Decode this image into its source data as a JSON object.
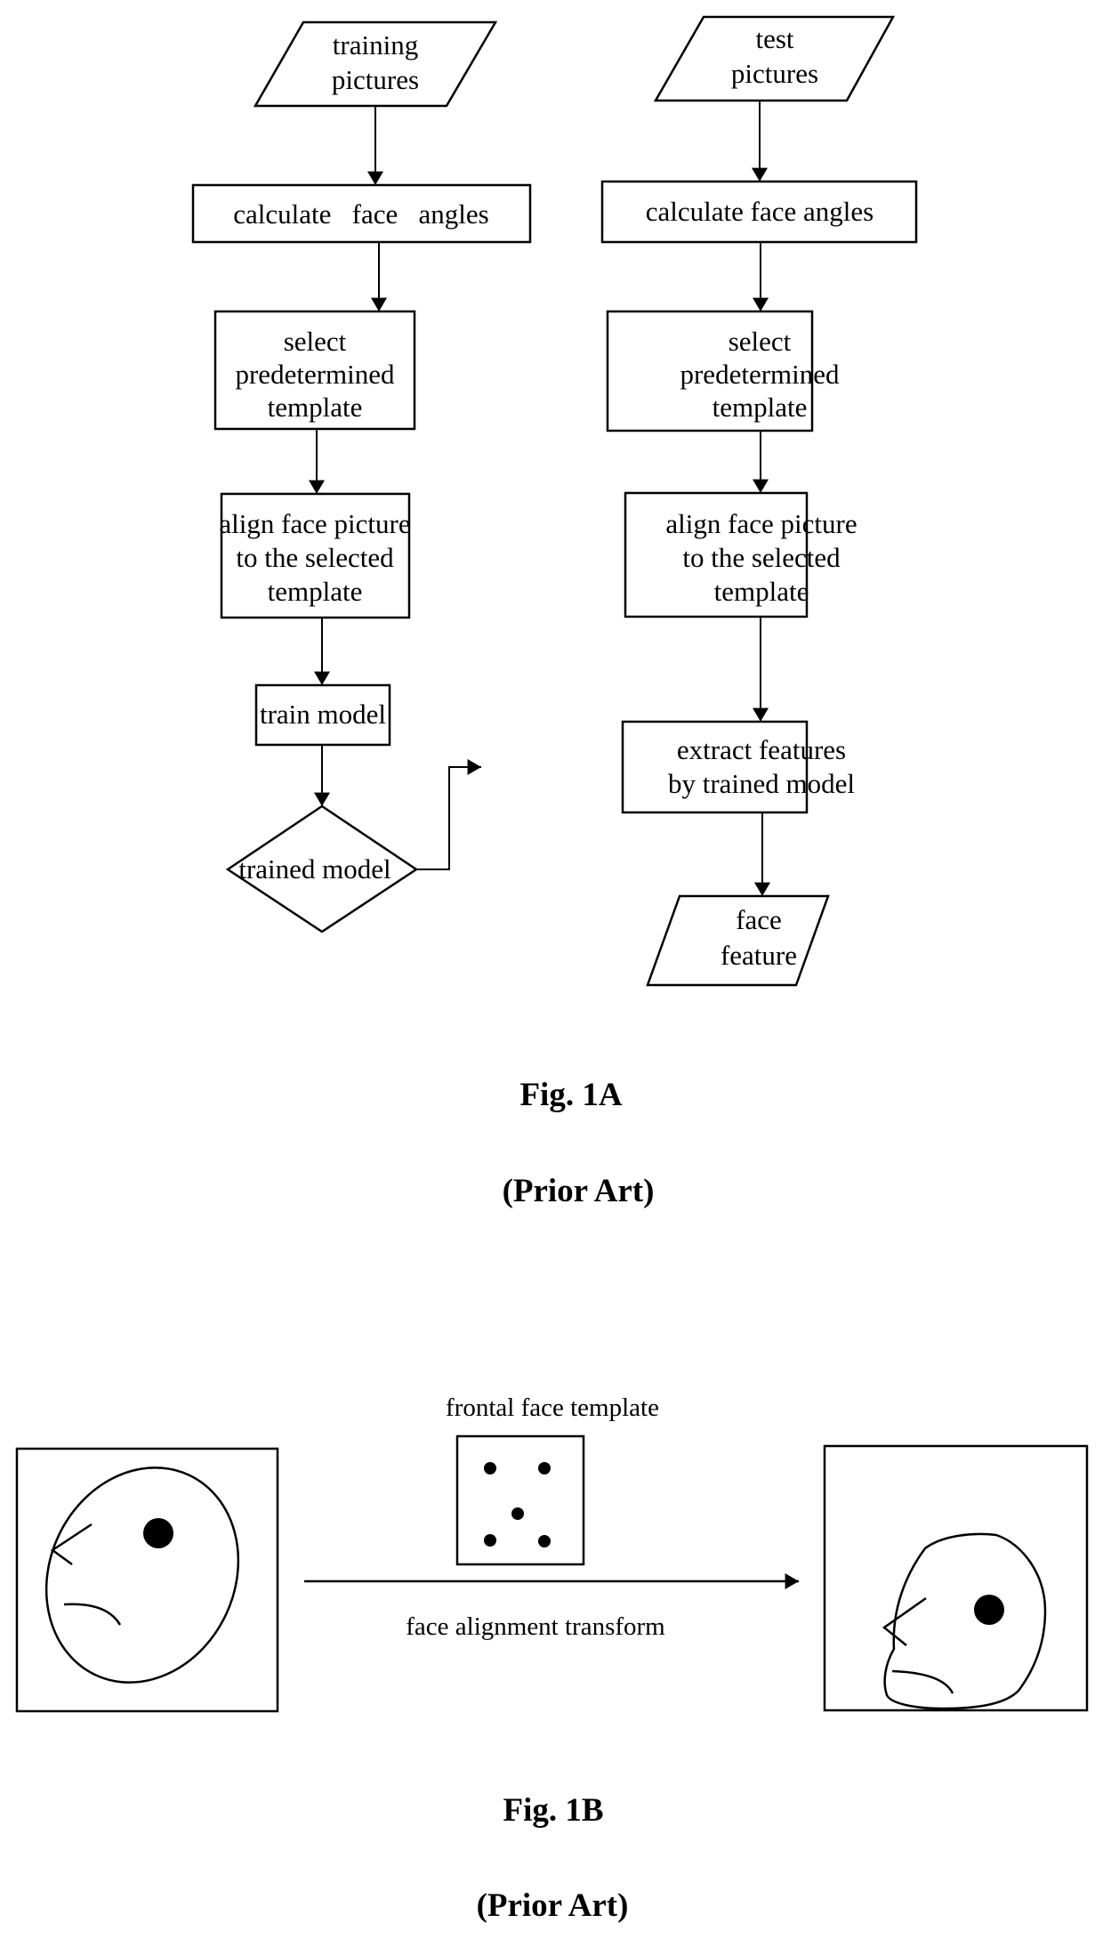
{
  "fig1a": {
    "left_column": {
      "input": [
        "training",
        "pictures"
      ],
      "step1": "calculate   face   angles",
      "step2": [
        "select",
        "predetermined",
        "template"
      ],
      "step3": [
        "align face picture",
        "to the selected",
        "template"
      ],
      "step4": "train model",
      "output": "trained model"
    },
    "right_column": {
      "input": [
        "test",
        "pictures"
      ],
      "step1": "calculate face angles",
      "step2": [
        "select",
        "predetermined",
        "template"
      ],
      "step3": [
        "align face picture",
        "to the selected",
        "template"
      ],
      "step4": [
        "extract features",
        "by trained model"
      ],
      "output": [
        "face",
        "feature"
      ]
    },
    "caption": "Fig. 1A",
    "subcaption": "(Prior Art)"
  },
  "fig1b": {
    "template_label": "frontal face template",
    "transform_label": "face alignment transform",
    "caption": "Fig. 1B",
    "subcaption": "(Prior Art)"
  }
}
